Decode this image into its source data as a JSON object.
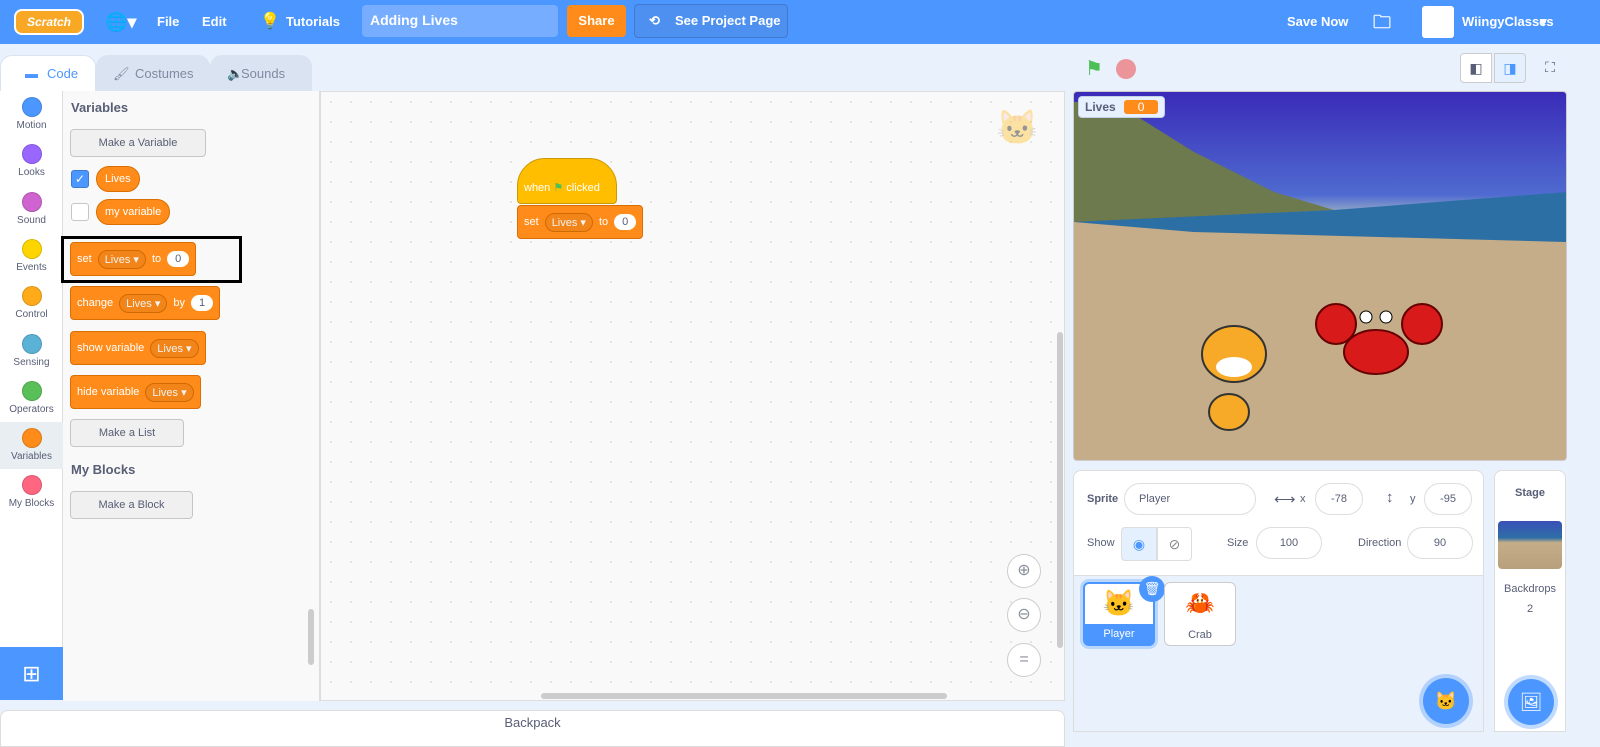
{
  "menu": {
    "logo": "Scratch",
    "file": "File",
    "edit": "Edit",
    "tutorials": "Tutorials",
    "project_title": "Adding Lives",
    "share": "Share",
    "see_project_page": "See Project Page",
    "save_now": "Save Now",
    "username": "WiingyClasses"
  },
  "tabs": [
    {
      "label": "Code"
    },
    {
      "label": "Costumes"
    },
    {
      "label": "Sounds"
    }
  ],
  "categories": [
    {
      "label": "Motion",
      "color": "#4c97ff"
    },
    {
      "label": "Looks",
      "color": "#9966ff"
    },
    {
      "label": "Sound",
      "color": "#cf63cf"
    },
    {
      "label": "Events",
      "color": "#ffd500"
    },
    {
      "label": "Control",
      "color": "#ffab19"
    },
    {
      "label": "Sensing",
      "color": "#5cb1d6"
    },
    {
      "label": "Operators",
      "color": "#59c059"
    },
    {
      "label": "Variables",
      "color": "#ff8c1a"
    },
    {
      "label": "My Blocks",
      "color": "#ff6680"
    }
  ],
  "palette": {
    "variables_heading": "Variables",
    "make_variable": "Make a Variable",
    "vars": [
      {
        "name": "Lives",
        "checked": true
      },
      {
        "name": "my variable",
        "checked": false
      }
    ],
    "set_block": {
      "op": "set",
      "var": "Lives",
      "to": "to",
      "value": "0"
    },
    "change_block": {
      "op": "change",
      "var": "Lives",
      "by": "by",
      "value": "1"
    },
    "show_block": {
      "op": "show variable",
      "var": "Lives"
    },
    "hide_block": {
      "op": "hide variable",
      "var": "Lives"
    },
    "make_list": "Make a List",
    "myblocks_heading": "My Blocks",
    "make_block": "Make a Block"
  },
  "script": {
    "hat": {
      "when": "when",
      "clicked": "clicked"
    },
    "set": {
      "op": "set",
      "var": "Lives",
      "to": "to",
      "value": "0"
    }
  },
  "backpack": "Backpack",
  "stage": {
    "monitor_label": "Lives",
    "monitor_value": "0"
  },
  "sprite_info": {
    "sprite_label": "Sprite",
    "sprite_name": "Player",
    "x_label": "x",
    "x": "-78",
    "y_label": "y",
    "y": "-95",
    "show_label": "Show",
    "size_label": "Size",
    "size": "100",
    "direction_label": "Direction",
    "direction": "90"
  },
  "sprites": [
    {
      "name": "Player",
      "selected": true
    },
    {
      "name": "Crab",
      "selected": false
    }
  ],
  "stage_panel": {
    "title": "Stage",
    "backdrops_label": "Backdrops",
    "backdrops_count": "2"
  }
}
